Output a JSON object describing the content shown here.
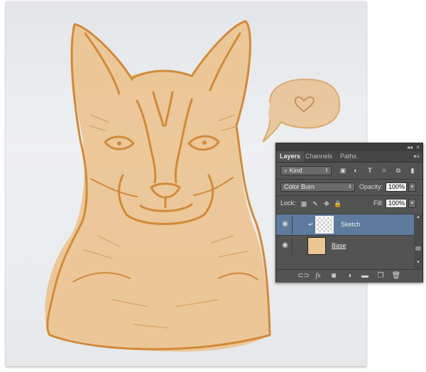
{
  "panel": {
    "controls": {
      "collapse": "◂◂",
      "close": "×"
    },
    "tabs": [
      {
        "label": "Layers",
        "active": true
      },
      {
        "label": "Channels",
        "active": false
      },
      {
        "label": "Paths",
        "active": false
      }
    ],
    "menu_icon": "▾≡",
    "filter": {
      "search_glyph": "⌕",
      "kind_label": "Kind",
      "icons": [
        "image-filter-icon",
        "adjustment-filter-icon",
        "type-filter-icon",
        "shape-filter-icon",
        "smart-object-filter-icon",
        "filter-toggle-icon"
      ]
    },
    "blend_mode": "Color Burn",
    "opacity": {
      "label": "Opacity:",
      "value": "100%"
    },
    "lock": {
      "label": "Lock:",
      "icons": [
        "lock-transparent-icon",
        "lock-image-icon",
        "lock-position-icon",
        "lock-all-icon"
      ]
    },
    "fill": {
      "label": "Fill:",
      "value": "100%"
    },
    "layers": [
      {
        "name": "Sketch",
        "selected": true,
        "clipped": true,
        "visible": true
      },
      {
        "name": "Base",
        "selected": false,
        "clipped": false,
        "visible": true
      }
    ],
    "bottom_icons": [
      "link-layers-icon",
      "fx-icon",
      "add-mask-icon",
      "adjustment-layer-icon",
      "new-group-icon",
      "new-layer-icon",
      "delete-layer-icon"
    ],
    "fx_label": "fx"
  },
  "colors": {
    "panel_bg": "#535353",
    "selected_layer": "#5e7a9c",
    "sketch_stroke": "#d18a3a",
    "fill_tone": "#ebc594"
  }
}
